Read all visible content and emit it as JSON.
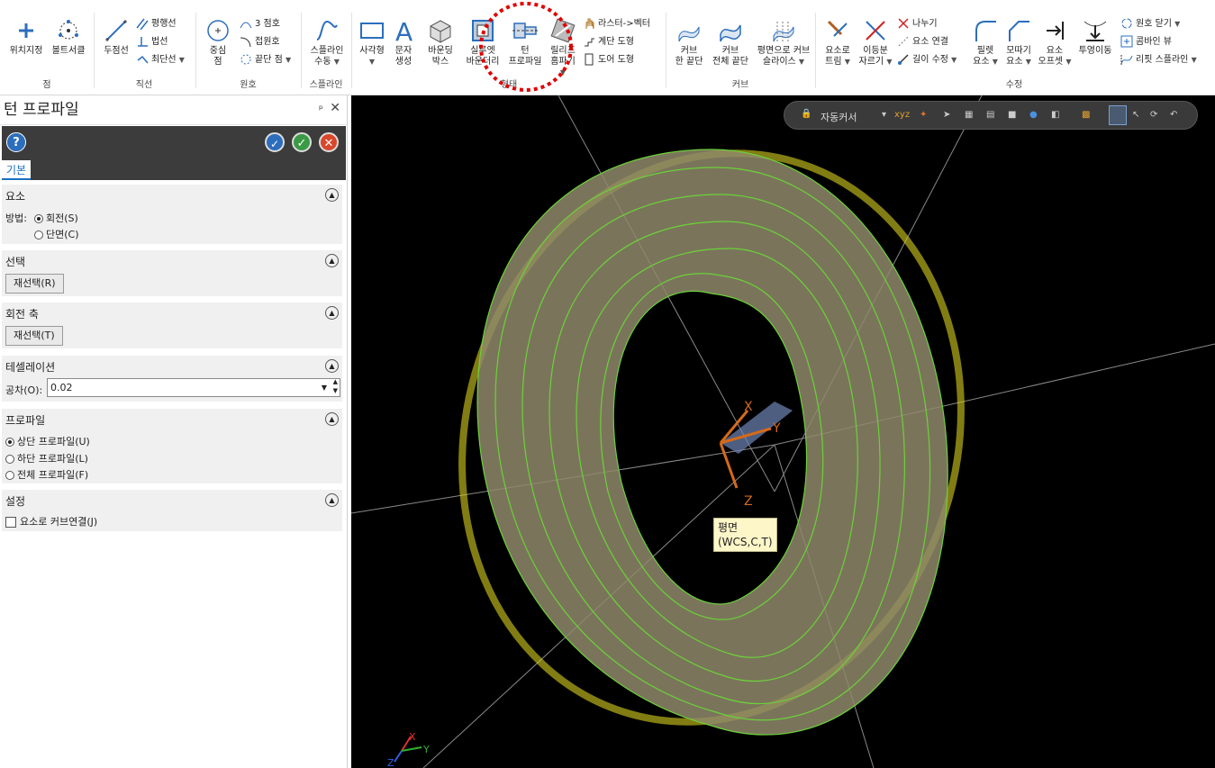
{
  "ribbon": {
    "groups": [
      {
        "id": "point",
        "label": "점"
      },
      {
        "id": "line",
        "label": "직선"
      },
      {
        "id": "arc",
        "label": "원호"
      },
      {
        "id": "spline",
        "label": "스플라인"
      },
      {
        "id": "shape",
        "label": "형태"
      },
      {
        "id": "curve",
        "label": "커브"
      },
      {
        "id": "edit",
        "label": "수정"
      }
    ],
    "point_buttons": [
      "위치지정",
      "볼트서클"
    ],
    "line": {
      "big": "두점선",
      "small": [
        "평행선",
        "법선",
        "최단선"
      ]
    },
    "arc": {
      "big_1": "중심",
      "big_2": "점",
      "small": [
        "3 점호",
        "접원호",
        "끝단 점"
      ]
    },
    "spline": {
      "l1": "스플라인",
      "l2": "수동"
    },
    "shape_buttons": [
      {
        "l1": "사각형",
        "l2": ""
      },
      {
        "l1": "문자",
        "l2": "생성"
      },
      {
        "l1": "바운딩",
        "l2": "박스"
      },
      {
        "l1": "실루엣",
        "l2": "바운더리"
      },
      {
        "l1": "턴",
        "l2": "프로파일"
      },
      {
        "l1": "릴리프",
        "l2": "홈파기"
      }
    ],
    "shape_small": [
      "라스터->벡터",
      "계단 도형",
      "도어 도형"
    ],
    "curve_buttons": [
      {
        "l1": "커브",
        "l2": "한 끝단"
      },
      {
        "l1": "커브",
        "l2": "전체 끝단"
      },
      {
        "l1": "평면으로 커브",
        "l2": "슬라이스"
      }
    ],
    "edit_big": [
      {
        "l1": "요소로",
        "l2": "트림"
      },
      {
        "l1": "이등분",
        "l2": "자르기"
      }
    ],
    "edit_small_1": [
      "나누기",
      "요소 연결",
      "길이 수정"
    ],
    "edit_big_2": [
      {
        "l1": "필렛",
        "l2": "요소"
      },
      {
        "l1": "모따기",
        "l2": "요소"
      },
      {
        "l1": "요소",
        "l2": "오프셋"
      },
      {
        "l1": "투영이동",
        "l2": ""
      }
    ],
    "edit_small_2": [
      "원호 닫기",
      "콤바인 뷰",
      "리핏 스플라인"
    ]
  },
  "panel": {
    "title": "턴 프로파일",
    "tab": "기본",
    "sections": {
      "element": {
        "title": "요소",
        "method_label": "방법:",
        "options": [
          "회전(S)",
          "단면(C)"
        ],
        "selected": 0
      },
      "selection": {
        "title": "선택",
        "button": "재선택(R)"
      },
      "axis": {
        "title": "회전 축",
        "button": "재선택(T)"
      },
      "tessellation": {
        "title": "테셀레이션",
        "tol_label": "공차(O):",
        "tol_value": "0.02"
      },
      "profile": {
        "title": "프로파일",
        "options": [
          "상단 프로파일(U)",
          "하단 프로파일(L)",
          "전체 프로파일(F)"
        ],
        "selected": 0
      },
      "settings": {
        "title": "설정",
        "checkbox": "요소로 커브연결(J)",
        "checked": false
      }
    }
  },
  "viewport": {
    "toolbar_label": "자동커서",
    "tooltip_line1": "평면",
    "tooltip_line2": "(WCS,C,T)",
    "axis_x": "X",
    "axis_y": "Y",
    "axis_z": "Z",
    "mini_x": "X",
    "mini_y": "Y",
    "mini_z": "Z"
  },
  "colors": {
    "accent_blue": "#2c6ebd",
    "wire_green": "#6cd13a",
    "glow_yellow": "#d8d020",
    "highlight_red": "#e00000"
  }
}
